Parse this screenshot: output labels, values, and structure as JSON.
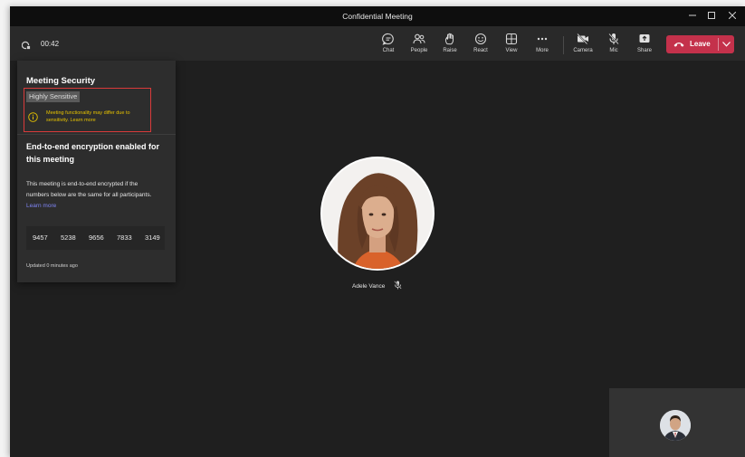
{
  "window": {
    "title": "Confidential Meeting"
  },
  "toolbar": {
    "timer": "00:42",
    "buttons": [
      {
        "label": "Chat",
        "icon": "chat-icon"
      },
      {
        "label": "People",
        "icon": "people-icon"
      },
      {
        "label": "Raise",
        "icon": "raise-hand-icon"
      },
      {
        "label": "React",
        "icon": "react-smiley-icon"
      },
      {
        "label": "View",
        "icon": "view-grid-icon"
      },
      {
        "label": "More",
        "icon": "more-dots-icon"
      },
      {
        "label": "Camera",
        "icon": "camera-off-icon"
      },
      {
        "label": "Mic",
        "icon": "mic-off-icon"
      },
      {
        "label": "Share",
        "icon": "share-icon"
      }
    ],
    "leave_label": "Leave"
  },
  "security_panel": {
    "title": "Meeting Security",
    "sensitivity_label": "Highly Sensitive",
    "warning_text": "Meeting functionality may differ due to sensitivity.",
    "warning_link": "Learn more",
    "e2e_title": "End-to-end encryption enabled for this meeting",
    "e2e_description": "This meeting is end-to-end encrypted if the numbers below are the same for all participants.",
    "e2e_link": "Learn more",
    "codes": [
      "9457",
      "5238",
      "9656",
      "7833",
      "3149"
    ],
    "updated": "Updated 0 minutes ago"
  },
  "participant": {
    "name": "Adele Vance",
    "mic_state": "muted"
  },
  "colors": {
    "leave": "#c4314b",
    "warning": "#e6c200",
    "link": "#7f85f5",
    "highlight": "#d93a3a"
  }
}
